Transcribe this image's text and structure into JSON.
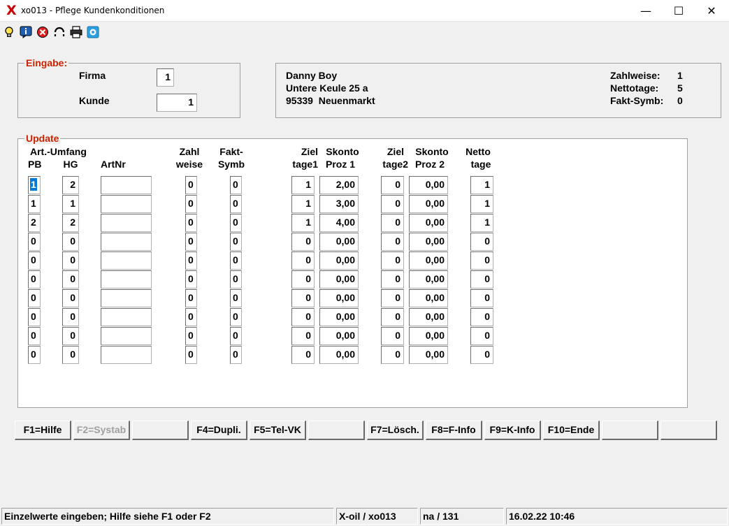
{
  "window": {
    "logo": "X",
    "title": "xo013 - Pflege Kundenkonditionen",
    "minimize_glyph": "—",
    "maximize_glyph": "☐",
    "close_glyph": "✕"
  },
  "toolbar": {
    "icons": [
      "lightbulb-icon",
      "info-icon",
      "cancel-icon",
      "refresh-icon",
      "print-icon",
      "help-icon"
    ]
  },
  "eingabe": {
    "legend": "Eingabe:",
    "firma_label": "Firma",
    "firma_value": "1",
    "kunde_label": "Kunde",
    "kunde_value": "1"
  },
  "customer": {
    "name": "Danny Boy",
    "street": "Untere Keule 25 a",
    "city": "95339  Neuenmarkt",
    "zahlweise_label": "Zahlweise:",
    "zahlweise_value": "1",
    "nettotage_label": "Nettotage:",
    "nettotage_value": "5",
    "faktsymb_label": "Fakt-Symb:",
    "faktsymb_value": "0"
  },
  "update": {
    "legend": "Update",
    "headers": {
      "art_umfang": "Art.-Umfang",
      "pb": "PB",
      "hg": "HG",
      "artnr": "ArtNr",
      "zahl1": "Zahl",
      "zahl2": "weise",
      "fakt1": "Fakt-",
      "fakt2": "Symb",
      "ziel1_1": "Ziel",
      "ziel1_2": "tage1",
      "skonto1_1": "Skonto",
      "skonto1_2": "Proz 1",
      "ziel2_1": "Ziel",
      "ziel2_2": "tage2",
      "skonto2_1": "Skonto",
      "skonto2_2": "Proz 2",
      "netto1": "Netto",
      "netto2": "tage"
    },
    "rows": [
      {
        "pb": "1",
        "hg": "2",
        "artnr": "",
        "zahlweise": "0",
        "faktsymb": "0",
        "ziel1": "1",
        "skonto1": "2,00",
        "ziel2": "0",
        "skonto2": "0,00",
        "netto": "1"
      },
      {
        "pb": "1",
        "hg": "1",
        "artnr": "",
        "zahlweise": "0",
        "faktsymb": "0",
        "ziel1": "1",
        "skonto1": "3,00",
        "ziel2": "0",
        "skonto2": "0,00",
        "netto": "1"
      },
      {
        "pb": "2",
        "hg": "2",
        "artnr": "",
        "zahlweise": "0",
        "faktsymb": "0",
        "ziel1": "1",
        "skonto1": "4,00",
        "ziel2": "0",
        "skonto2": "0,00",
        "netto": "1"
      },
      {
        "pb": "0",
        "hg": "0",
        "artnr": "",
        "zahlweise": "0",
        "faktsymb": "0",
        "ziel1": "0",
        "skonto1": "0,00",
        "ziel2": "0",
        "skonto2": "0,00",
        "netto": "0"
      },
      {
        "pb": "0",
        "hg": "0",
        "artnr": "",
        "zahlweise": "0",
        "faktsymb": "0",
        "ziel1": "0",
        "skonto1": "0,00",
        "ziel2": "0",
        "skonto2": "0,00",
        "netto": "0"
      },
      {
        "pb": "0",
        "hg": "0",
        "artnr": "",
        "zahlweise": "0",
        "faktsymb": "0",
        "ziel1": "0",
        "skonto1": "0,00",
        "ziel2": "0",
        "skonto2": "0,00",
        "netto": "0"
      },
      {
        "pb": "0",
        "hg": "0",
        "artnr": "",
        "zahlweise": "0",
        "faktsymb": "0",
        "ziel1": "0",
        "skonto1": "0,00",
        "ziel2": "0",
        "skonto2": "0,00",
        "netto": "0"
      },
      {
        "pb": "0",
        "hg": "0",
        "artnr": "",
        "zahlweise": "0",
        "faktsymb": "0",
        "ziel1": "0",
        "skonto1": "0,00",
        "ziel2": "0",
        "skonto2": "0,00",
        "netto": "0"
      },
      {
        "pb": "0",
        "hg": "0",
        "artnr": "",
        "zahlweise": "0",
        "faktsymb": "0",
        "ziel1": "0",
        "skonto1": "0,00",
        "ziel2": "0",
        "skonto2": "0,00",
        "netto": "0"
      },
      {
        "pb": "0",
        "hg": "0",
        "artnr": "",
        "zahlweise": "0",
        "faktsymb": "0",
        "ziel1": "0",
        "skonto1": "0,00",
        "ziel2": "0",
        "skonto2": "0,00",
        "netto": "0"
      }
    ]
  },
  "fkeys": [
    {
      "label": "F1=Hilfe",
      "disabled": false
    },
    {
      "label": "F2=Systab",
      "disabled": true
    },
    {
      "label": "",
      "disabled": false
    },
    {
      "label": "F4=Dupli.",
      "disabled": false
    },
    {
      "label": "F5=Tel-VK",
      "disabled": false
    },
    {
      "label": "",
      "disabled": false
    },
    {
      "label": "F7=Lösch.",
      "disabled": false
    },
    {
      "label": "F8=F-Info",
      "disabled": false
    },
    {
      "label": "F9=K-Info",
      "disabled": false
    },
    {
      "label": "F10=Ende",
      "disabled": false
    },
    {
      "label": "",
      "disabled": false
    },
    {
      "label": "",
      "disabled": false
    }
  ],
  "statusbar": {
    "message": "Einzelwerte eingeben; Hilfe siehe F1 oder F2",
    "app": "X-oil / xo013",
    "record": "na / 131",
    "datetime": "16.02.22 10:46"
  }
}
